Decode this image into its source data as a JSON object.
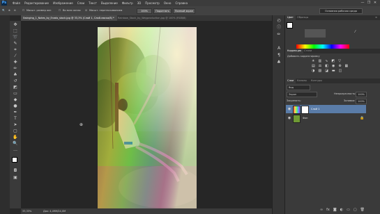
{
  "app": {
    "logo": "Ps"
  },
  "menu": [
    "Файл",
    "Редактирование",
    "Изображение",
    "Слои",
    "Текст",
    "Выделение",
    "Фильтр",
    "3D",
    "Просмотр",
    "Окно",
    "Справка"
  ],
  "window_controls": [
    "—",
    "❐",
    "✕"
  ],
  "options": {
    "snap_label": "Масшт. размер окн",
    "all_windows_label": "Во всех окнах",
    "scrubby_label": "Масшт. перетаскиванием",
    "zoom_value": "100%",
    "fit_button": "Подогнать",
    "fill_button": "Полный экран",
    "workspace": "Основная рабочая среда"
  },
  "tabs": [
    {
      "label": "Swinging_1_Notes_by_Erzalo_stock.jpg @ 33,3% (Слой 1, Слой-маска/8) *",
      "active": true
    },
    {
      "label": "Rainbow_Stock_by_Wegproduction.jpg @ 100% (RGB/8)",
      "active": false
    }
  ],
  "status": {
    "zoom": "33,33%",
    "doc": "Док: 4,49М/24,0М"
  },
  "panels": {
    "color_tabs": [
      "Цвет",
      "Образцы"
    ],
    "adjust_tabs": [
      "Коррекция",
      "Стили"
    ],
    "adjust_title": "Добавить корректировку",
    "layer_tabs": [
      "Слои",
      "Каналы",
      "Контуры"
    ],
    "kind_label": "Вид",
    "blend_mode": "Экран",
    "opacity_label": "Непрозрачность:",
    "opacity_value": "100%",
    "lock_label": "Закрепить:",
    "fill_label": "Заливка:",
    "fill_value": "100%",
    "layers": [
      {
        "name": "Слой 1",
        "selected": true
      },
      {
        "name": "Фон",
        "selected": false
      }
    ]
  },
  "colors": {
    "accent_selected": "#5a7ca8",
    "panel": "#3a3a3a"
  }
}
